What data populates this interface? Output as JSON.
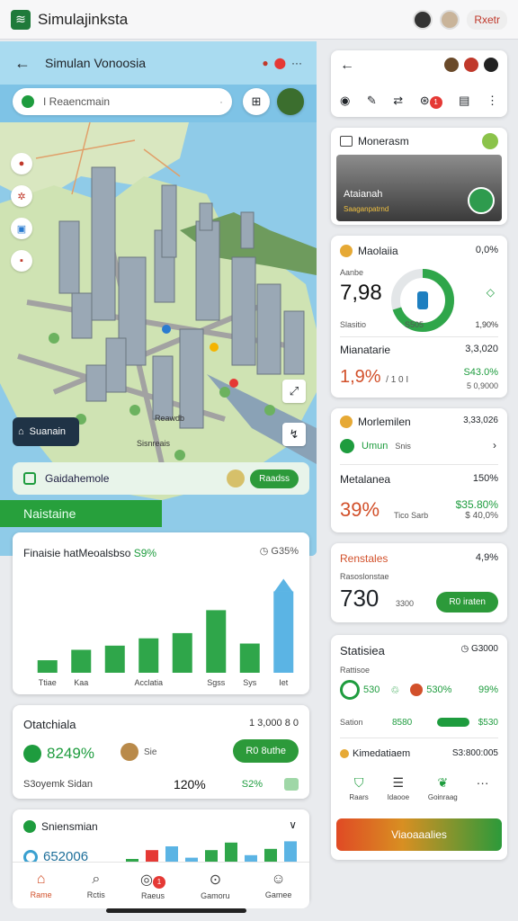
{
  "app": {
    "title": "Simulajinksta",
    "top_button": "Rxetr"
  },
  "map_panel": {
    "title": "Simulan Vonoosia",
    "search_placeholder": "I Reaencmain",
    "pin_label": "Suanain",
    "row_label": "Gaidahemole",
    "row_button": "Raadss",
    "band_label": "Naistaine",
    "labels": [
      "Reawdb",
      "Sisnreais"
    ]
  },
  "chart_card": {
    "title": "Finaisie hatMeoalsbso",
    "title_accent": "S9%",
    "right_label": "G35%",
    "chart_data": {
      "type": "bar",
      "categories": [
        "Ttiae",
        "Kaa",
        "",
        "Acclatia",
        "",
        "Sgss",
        "Sys",
        "Iet"
      ],
      "values": [
        12,
        22,
        26,
        33,
        38,
        60,
        28,
        78
      ],
      "colors": [
        "#2fa64a",
        "#2fa64a",
        "#2fa64a",
        "#2fa64a",
        "#2fa64a",
        "#2fa64a",
        "#2fa64a",
        "#5bb4e4"
      ],
      "ylim": [
        0,
        100
      ]
    }
  },
  "stat1": {
    "title": "Otatchiala",
    "right": "1 3,000 8 0",
    "value": "8249%",
    "mid_label": "Sie",
    "button": "R0 8uthe",
    "row_label": "S3oyemk Sidan",
    "row_value": "120%",
    "row_green": "S2%"
  },
  "stat2": {
    "title": "Sniensmian",
    "value": "652006"
  },
  "mini_bars": {
    "values": [
      5,
      12,
      15,
      6,
      12,
      18,
      8,
      13,
      19
    ],
    "colors": [
      "#2fa64a",
      "#e53935",
      "#5bb4e4",
      "#5bb4e4",
      "#2fa64a",
      "#2fa64a",
      "#5bb4e4",
      "#2fa64a",
      "#5bb4e4"
    ]
  },
  "bottom_nav": [
    {
      "label": "Rame",
      "icon": "⌂"
    },
    {
      "label": "Rctis",
      "icon": "⌕"
    },
    {
      "label": "Raeus",
      "icon": "◎",
      "badge": "1"
    },
    {
      "label": "Gamoru",
      "icon": "⊙"
    },
    {
      "label": "Gamee",
      "icon": "☺"
    }
  ],
  "right": {
    "card1": {
      "title": "Monerasm",
      "img_caption": "Ataianah",
      "img_sub": "Saaganpatrnd"
    },
    "card2": {
      "title": "Maolaiia",
      "right": "0,0%",
      "small": "Aanbe",
      "big": "7,98",
      "small2": "Slasitio",
      "donut_label": "S505",
      "right2": "1,90%",
      "l4": "Mianatarie",
      "l4r": "3,3,020",
      "pct": "1,9%",
      "pct_sub": "/ 1 0 I",
      "gr": "S43.0%",
      "gr2": "5 0,9000",
      "donut_value": 0.7
    },
    "card3": {
      "title": "Morlemilen",
      "right": "3,33,026",
      "row_label": "Umun",
      "row_meta": "Snis",
      "l": "Metalanea",
      "lr": "150%",
      "pct": "39%",
      "pm": "Tico Sarb",
      "gr": "$35.80%",
      "gr2": "$ 40,0%"
    },
    "card4": {
      "title": "Renstales",
      "right": "4,9%",
      "small": "Rasoslonstae",
      "big": "730",
      "m": "3300",
      "button": "R0 iraten"
    },
    "card5": {
      "title": "Statisiea",
      "right": "G3000",
      "small": "Rattisoe",
      "v1": "530",
      "v2": "530%",
      "v3": "99%",
      "s2": "Sation",
      "s2v": "8580",
      "s2r": "$530",
      "l": "Kimedatiaem",
      "lr": "S3:800:005",
      "tabs": [
        "Raars",
        "Idaooe",
        "Goinraag"
      ],
      "cta": "Viaoaaalies"
    }
  }
}
